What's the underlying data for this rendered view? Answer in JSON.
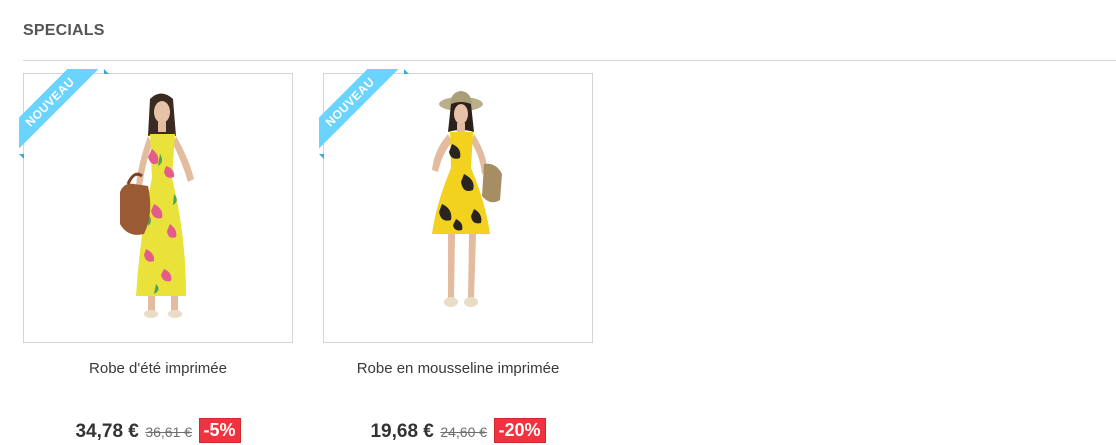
{
  "section": {
    "title": "SPECIALS"
  },
  "colors": {
    "ribbon": "#6ad4ff",
    "reduction_badge": "#f13340",
    "border": "#d6d4d4"
  },
  "products": [
    {
      "badge": "NOUVEAU",
      "name": "Robe d'été imprimée",
      "price": "34,78 €",
      "old_price": "36,61 €",
      "reduction": "-5%"
    },
    {
      "badge": "NOUVEAU",
      "name": "Robe en mousseline imprimée",
      "price": "19,68 €",
      "old_price": "24,60 €",
      "reduction": "-20%"
    }
  ]
}
